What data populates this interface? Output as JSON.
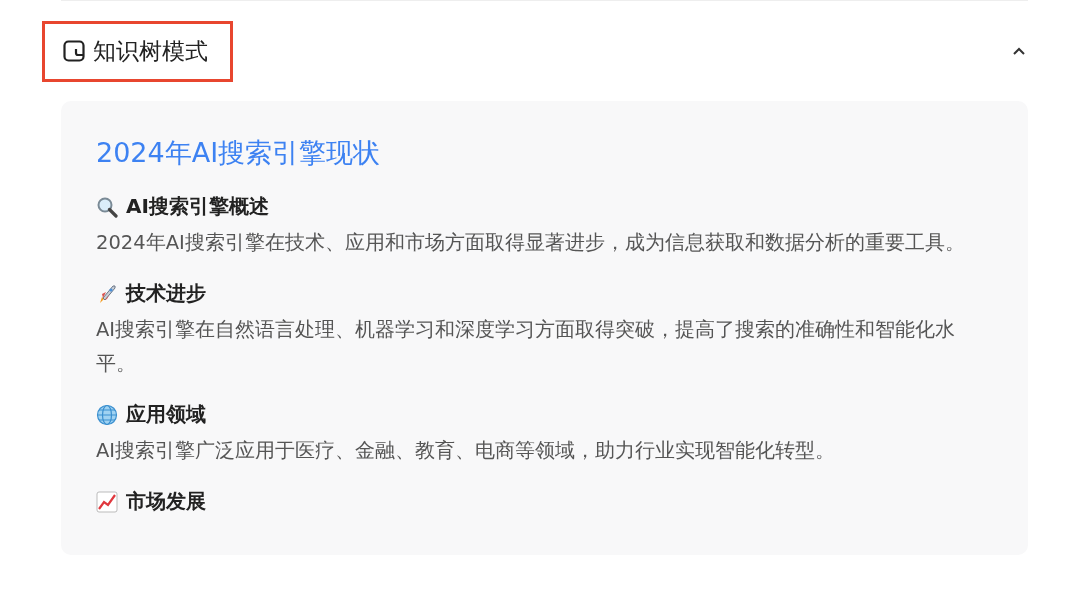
{
  "panel": {
    "title": "知识树模式",
    "expanded": true
  },
  "card": {
    "title": "2024年AI搜索引擎现状",
    "sections": [
      {
        "kind": "search",
        "heading": "AI搜索引擎概述",
        "text": "2024年AI搜索引擎在技术、应用和市场方面取得显著进步，成为信息获取和数据分析的重要工具。"
      },
      {
        "kind": "rocket",
        "heading": "技术进步",
        "text": "AI搜索引擎在自然语言处理、机器学习和深度学习方面取得突破，提高了搜索的准确性和智能化水平。"
      },
      {
        "kind": "globe",
        "heading": "应用领域",
        "text": "AI搜索引擎广泛应用于医疗、金融、教育、电商等领域，助力行业实现智能化转型。"
      },
      {
        "kind": "chart",
        "heading": "市场发展"
      }
    ]
  }
}
